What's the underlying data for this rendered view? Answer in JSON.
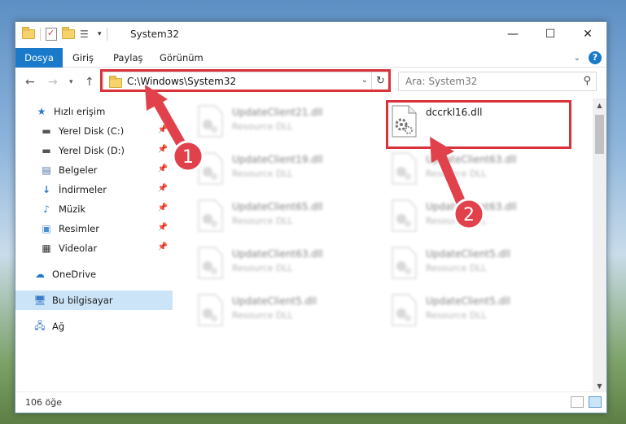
{
  "window": {
    "title": "System32"
  },
  "ribbon": {
    "tabs": [
      "Dosya",
      "Giriş",
      "Paylaş",
      "Görünüm"
    ]
  },
  "address": {
    "path": "C:\\Windows\\System32"
  },
  "search": {
    "placeholder": "Ara: System32"
  },
  "sidebar": {
    "items": [
      {
        "label": "Hızlı erişim",
        "icon": "star-icon"
      },
      {
        "label": "Yerel Disk (C:)",
        "icon": "drive-icon"
      },
      {
        "label": "Yerel Disk (D:)",
        "icon": "drive-icon"
      },
      {
        "label": "Belgeler",
        "icon": "documents-icon"
      },
      {
        "label": "İndirmeler",
        "icon": "download-icon"
      },
      {
        "label": "Müzik",
        "icon": "music-icon"
      },
      {
        "label": "Resimler",
        "icon": "pictures-icon"
      },
      {
        "label": "Videolar",
        "icon": "videos-icon"
      },
      {
        "label": "OneDrive",
        "icon": "cloud-icon"
      },
      {
        "label": "Bu bilgisayar",
        "icon": "computer-icon"
      },
      {
        "label": "Ağ",
        "icon": "network-icon"
      }
    ]
  },
  "files": [
    {
      "name": "UpdateClient21.dll",
      "type": "Resource DLL"
    },
    {
      "name": "dccrkl16.dll",
      "type": ""
    },
    {
      "name": "UpdateClient19.dll",
      "type": "Resource DLL"
    },
    {
      "name": "UpdateClient63.dll",
      "type": "Resource DLL"
    },
    {
      "name": "UpdateClient65.dll",
      "type": "Resource DLL"
    },
    {
      "name": "UpdateClient63.dll",
      "type": "Resource DLL"
    },
    {
      "name": "UpdateClient63.dll",
      "type": "Resource DLL"
    },
    {
      "name": "UpdateClient5.dll",
      "type": "Resource DLL"
    },
    {
      "name": "UpdateClient5.dll",
      "type": "Resource DLL"
    },
    {
      "name": "UpdateClient5.dll",
      "type": "Resource DLL"
    }
  ],
  "status": {
    "count": "106 öğe"
  },
  "annotations": {
    "step1": "1",
    "step2": "2",
    "color": "#e0414a"
  }
}
